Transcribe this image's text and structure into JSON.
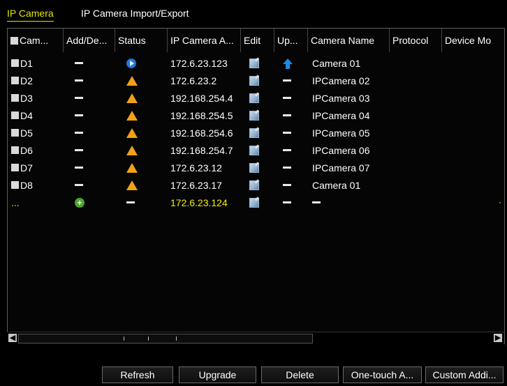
{
  "tabs": [
    {
      "label": "IP Camera"
    },
    {
      "label": "IP Camera Import/Export"
    }
  ],
  "table": {
    "headers": {
      "cam": "Cam...",
      "add": "Add/De...",
      "status": "Status",
      "ip": "IP Camera A...",
      "edit": "Edit",
      "up": "Up...",
      "name": "Camera Name",
      "protocol": "Protocol",
      "model": "Device Mo"
    },
    "rows": [
      {
        "cam": "D1",
        "add": "dash",
        "status": "play-icon",
        "ip": "172.6.23.123",
        "edit": "edit-icon",
        "up": "upgrade-icon",
        "name": "Camera 01"
      },
      {
        "cam": "D2",
        "add": "dash",
        "status": "warning-icon",
        "ip": "172.6.23.2",
        "edit": "edit-icon",
        "up": "dash",
        "name": "IPCamera 02"
      },
      {
        "cam": "D3",
        "add": "dash",
        "status": "warning-icon",
        "ip": "192.168.254.4",
        "edit": "edit-icon",
        "up": "dash",
        "name": "IPCamera 03"
      },
      {
        "cam": "D4",
        "add": "dash",
        "status": "warning-icon",
        "ip": "192.168.254.5",
        "edit": "edit-icon",
        "up": "dash",
        "name": "IPCamera 04"
      },
      {
        "cam": "D5",
        "add": "dash",
        "status": "warning-icon",
        "ip": "192.168.254.6",
        "edit": "edit-icon",
        "up": "dash",
        "name": "IPCamera 05"
      },
      {
        "cam": "D6",
        "add": "dash",
        "status": "warning-icon",
        "ip": "192.168.254.7",
        "edit": "edit-icon",
        "up": "dash",
        "name": "IPCamera 06"
      },
      {
        "cam": "D7",
        "add": "dash",
        "status": "warning-icon",
        "ip": "172.6.23.12",
        "edit": "edit-icon",
        "up": "dash",
        "name": "IPCamera 07"
      },
      {
        "cam": "D8",
        "add": "dash",
        "status": "warning-icon",
        "ip": "172.6.23.17",
        "edit": "edit-icon",
        "up": "dash",
        "name": "Camera 01"
      }
    ],
    "new_row": {
      "cam": "...",
      "add": "add-icon",
      "status": "dash",
      "ip": "172.6.23.124",
      "edit": "edit-icon",
      "up": "dash",
      "name": "dash"
    }
  },
  "buttons": {
    "refresh": "Refresh",
    "upgrade": "Upgrade",
    "delete": "Delete",
    "one_touch": "One-touch A...",
    "custom_add": "Custom Addi..."
  },
  "colors": {
    "active_tab": "#e6e600",
    "warning": "#f0a11a",
    "new_ip_text": "#f3ef00",
    "play_status": "#1f78d4",
    "add": "#4aa628"
  }
}
